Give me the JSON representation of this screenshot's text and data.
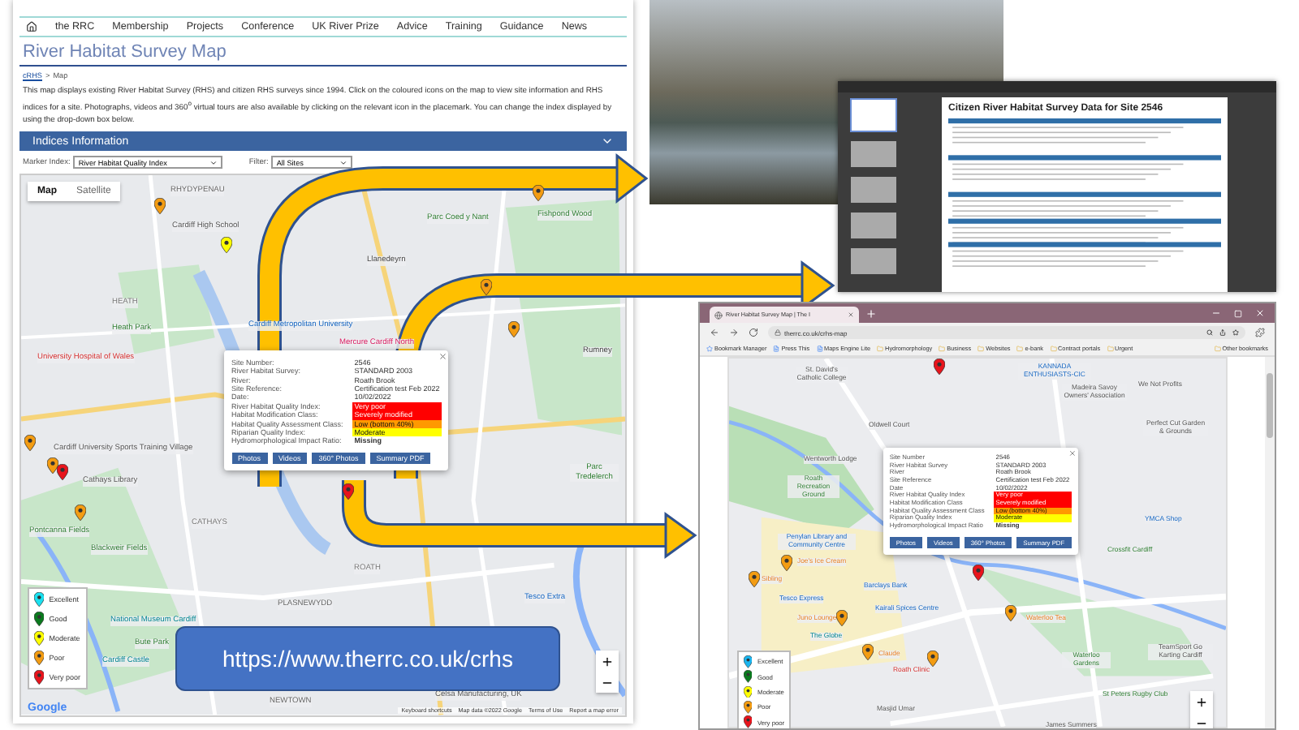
{
  "main_page": {
    "nav": [
      {
        "label": "the RRC"
      },
      {
        "label": "Membership"
      },
      {
        "label": "Projects"
      },
      {
        "label": "Conference"
      },
      {
        "label": "UK River Prize"
      },
      {
        "label": "Advice"
      },
      {
        "label": "Training"
      },
      {
        "label": "Guidance"
      },
      {
        "label": "News"
      }
    ],
    "title": "River Habitat Survey Map",
    "breadcrumb": {
      "link": "cRHS",
      "separator": ">",
      "current": "Map"
    },
    "intro": "This map displays existing River Habitat Survey (RHS) and citizen RHS surveys since 1994. Click on the coloured icons on the map to view site information and RHS indices for a site. Photographs, videos and 360$^{o}$ virtual tours are also available by clicking on the relevant icon in the placemark. You can change the index displayed by using the drop-down box below.",
    "panel": {
      "title": "Indices Information",
      "expanded": true
    },
    "controls": [
      {
        "label": "Marker Index:",
        "value": "River Habitat Quality Index"
      },
      {
        "label": "Filter:",
        "value": "All Sites"
      }
    ],
    "map": {
      "tabs": [
        {
          "label": "Map",
          "selected": true
        },
        {
          "label": "Satellite",
          "selected": false
        }
      ],
      "places": [
        "RHYDYPENAU",
        "Cardiff High School",
        "Parc Coed y Nant",
        "Fishpond Wood",
        "HEATH",
        "Heath Park",
        "Llanedeyrn",
        "Cardiff Metropolitan University",
        "Mercure Cardiff North",
        "Rumney",
        "University Hospital of Wales",
        "Cardiff University Sports Training Village",
        "Cathays Library",
        "Pontcanna Fields",
        "Blackweir Fields",
        "CATHAYS",
        "ROATH",
        "PLASNEWYDD",
        "National Museum Cardiff",
        "Bute Park",
        "Cardiff Castle",
        "Tesco Extra",
        "Parc Tredelerch",
        "NEWTOWN",
        "Celsa Manufacturing, UK"
      ],
      "pins": [
        {
          "color": "#f39c12"
        },
        {
          "color": "#ffff00"
        },
        {
          "color": "#f39c12"
        },
        {
          "color": "#f39c12"
        },
        {
          "color": "#f39c12"
        },
        {
          "color": "#f39c12"
        },
        {
          "color": "#f39c12"
        },
        {
          "color": "#e8141c"
        },
        {
          "color": "#f39c12"
        },
        {
          "color": "#e8141c"
        }
      ],
      "popup": {
        "rows": [
          {
            "label": "Site Number:",
            "value": "2546"
          },
          {
            "label": "River Habitat Survey:",
            "value": "STANDARD 2003"
          },
          {
            "label": "River:",
            "value": "Roath Brook"
          },
          {
            "label": "Site Reference:",
            "value": "Certification test Feb 2022"
          },
          {
            "label": "Date:",
            "value": "10/02/2022"
          },
          {
            "label": "River Habitat Quality Index:",
            "value": "Very poor",
            "color": "#ff0000"
          },
          {
            "label": "Habitat Modification Class:",
            "value": "Severely modified",
            "color": "#ff0000"
          },
          {
            "label": "Habitat Quality Assessment Class:",
            "value": "Low (bottom 40%)",
            "color": "#ff9900"
          },
          {
            "label": "Riparian Quality Index:",
            "value": "Moderate",
            "color": "#ffff00"
          },
          {
            "label": "Hydromorphological Impact Ratio:",
            "value": "Missing",
            "bold": true
          }
        ],
        "buttons": [
          "Photos",
          "Videos",
          "360° Photos",
          "Summary PDF"
        ]
      },
      "legend": [
        {
          "label": "Excellent",
          "color": "#19e0ef"
        },
        {
          "label": "Good",
          "color": "#0a7a1e"
        },
        {
          "label": "Moderate",
          "color": "#ffff00"
        },
        {
          "label": "Poor",
          "color": "#f39c12"
        },
        {
          "label": "Very poor",
          "color": "#e8141c"
        }
      ],
      "logo": "Google",
      "attribution": [
        "Keyboard shortcuts",
        "Map data ©2022 Google",
        "Terms of Use",
        "Report a map error"
      ]
    }
  },
  "url_banner": "https://www.therrc.co.uk/crhs",
  "document": {
    "title": "Citizen River Habitat Survey Data for Site 2546"
  },
  "browser": {
    "tab_title": "River Habitat Survey Map | The I",
    "url": "therrc.co.uk/crhs-map",
    "bookmarks": [
      {
        "label": "Bookmark Manager",
        "kind": "star"
      },
      {
        "label": "Press This",
        "kind": "page"
      },
      {
        "label": "Maps Engine Lite",
        "kind": "page"
      },
      {
        "label": "Hydromorphology",
        "kind": "folder"
      },
      {
        "label": "Business",
        "kind": "folder"
      },
      {
        "label": "Websites",
        "kind": "folder"
      },
      {
        "label": "e-bank",
        "kind": "folder"
      },
      {
        "label": "Contract portals",
        "kind": "folder"
      },
      {
        "label": "Urgent",
        "kind": "folder"
      },
      {
        "label": "Other bookmarks",
        "kind": "folder"
      }
    ],
    "map": {
      "places": [
        "St. David's Catholic College",
        "KANNADA ENTHUSIASTS-CIC",
        "Madeira Savoy Owners' Association",
        "We Not Profits",
        "Oldwell Court",
        "Perfect Cut Garden & Grounds",
        "Wentworth Lodge",
        "Roath Recreation Ground",
        "Penylan Library and Community Centre",
        "Joe's Ice Cream",
        "Sibling",
        "Barclays Bank",
        "Tesco Express",
        "Kairali Spices Centre",
        "Juno Lounge",
        "The Globe",
        "Claude",
        "Roath Clinic",
        "Waterloo Tea",
        "Waterloo Gardens",
        "YMCA Shop",
        "Crossfit Cardiff",
        "TeamSport Go Karting Cardiff",
        "St Peters Rugby Club",
        "Masjid Umar",
        "James Summers"
      ],
      "pins": [
        {
          "color": "#e8141c"
        },
        {
          "color": "#e8141c"
        },
        {
          "color": "#f39c12"
        },
        {
          "color": "#f39c12"
        },
        {
          "color": "#f39c12"
        },
        {
          "color": "#f39c12"
        },
        {
          "color": "#f39c12"
        },
        {
          "color": "#f39c12"
        }
      ],
      "popup": {
        "rows": [
          {
            "label": "Site Number",
            "value": "2546"
          },
          {
            "label": "River Habitat Survey",
            "value": "STANDARD 2003"
          },
          {
            "label": "River",
            "value": "Roath Brook"
          },
          {
            "label": "Site Reference",
            "value": "Certification test Feb 2022"
          },
          {
            "label": "Date",
            "value": "10/02/2022"
          },
          {
            "label": "River Habitat Quality Index",
            "value": "Very poor",
            "color": "#ff0000"
          },
          {
            "label": "Habitat Modification Class",
            "value": "Severely modified",
            "color": "#ff0000"
          },
          {
            "label": "Habitat Quality Assessment Class",
            "value": "Low (bottom 40%)",
            "color": "#ff9900"
          },
          {
            "label": "Riparian Quality Index",
            "value": "Moderate",
            "color": "#ffff00"
          },
          {
            "label": "Hydromorphological Impact Ratio",
            "value": "Missing",
            "bold": true
          }
        ],
        "buttons": [
          "Photos",
          "Videos",
          "360° Photos",
          "Summary PDF"
        ]
      },
      "legend": [
        {
          "label": "Excellent",
          "color": "#19b5ef"
        },
        {
          "label": "Good",
          "color": "#0a7a1e"
        },
        {
          "label": "Moderate",
          "color": "#ffff00"
        },
        {
          "label": "Poor",
          "color": "#f39c12"
        },
        {
          "label": "Very poor",
          "color": "#e8141c"
        }
      ]
    }
  }
}
